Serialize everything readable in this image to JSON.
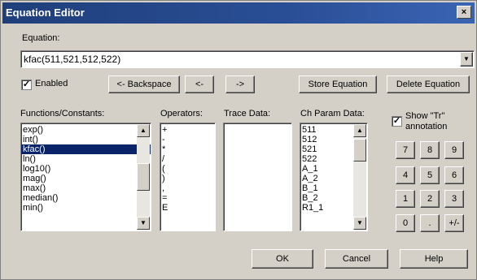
{
  "window": {
    "title": "Equation Editor",
    "close_glyph": "×"
  },
  "equation": {
    "label": "Equation:",
    "value": "kfac(511,521,512,522)"
  },
  "enabled": {
    "label": "Enabled",
    "checked": true
  },
  "buttons": {
    "backspace": "<- Backspace",
    "left": "<-",
    "right": "->",
    "store": "Store Equation",
    "delete": "Delete Equation",
    "ok": "OK",
    "cancel": "Cancel",
    "help": "Help"
  },
  "functions": {
    "label": "Functions/Constants:",
    "items": [
      "exp()",
      "int()",
      "kfac()",
      "ln()",
      "log10()",
      "mag()",
      "max()",
      "median()",
      "min()"
    ],
    "selected": "kfac()"
  },
  "operators": {
    "label": "Operators:",
    "items": [
      "+",
      "-",
      "*",
      "/",
      "(",
      ")",
      ",",
      "=",
      "E"
    ]
  },
  "trace": {
    "label": "Trace Data:"
  },
  "chparam": {
    "label": "Ch Param Data:",
    "items": [
      "511",
      "512",
      "521",
      "522",
      "A_1",
      "A_2",
      "B_1",
      "B_2",
      "R1_1"
    ]
  },
  "show_tr": {
    "line1": "Show \"Tr\"",
    "line2": "annotation",
    "checked": true
  },
  "keypad": [
    "7",
    "8",
    "9",
    "4",
    "5",
    "6",
    "1",
    "2",
    "3",
    "0",
    ".",
    "+/-"
  ]
}
